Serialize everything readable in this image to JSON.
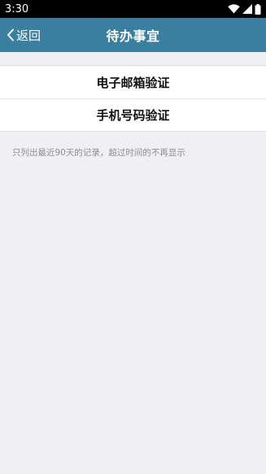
{
  "status_bar": {
    "time": "3:30",
    "icons": [
      "wifi-icon",
      "signal-icon",
      "battery-icon"
    ]
  },
  "nav": {
    "back_label": "返回",
    "title": "待办事宜",
    "background_color": "#3a7fa0"
  },
  "items": [
    {
      "label": "电子邮箱验证"
    },
    {
      "label": "手机号码验证"
    }
  ],
  "note": "只列出最近90天的记录，超过时间的不再显示"
}
